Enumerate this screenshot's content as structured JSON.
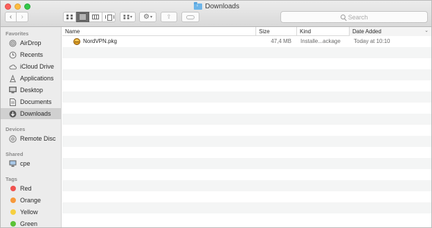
{
  "window": {
    "title": "Downloads",
    "title_icon": "downloads-folder-icon"
  },
  "toolbar": {
    "back_glyph": "‹",
    "forward_glyph": "›",
    "view_modes": [
      "icon",
      "list",
      "column",
      "cover-flow"
    ],
    "active_view": "list",
    "search_placeholder": "Search"
  },
  "sidebar": {
    "favorites_title": "Favorites",
    "favorites": [
      {
        "label": "AirDrop",
        "icon": "airdrop-icon"
      },
      {
        "label": "Recents",
        "icon": "clock-icon"
      },
      {
        "label": "iCloud Drive",
        "icon": "cloud-icon"
      },
      {
        "label": "Applications",
        "icon": "applications-icon"
      },
      {
        "label": "Desktop",
        "icon": "desktop-icon"
      },
      {
        "label": "Documents",
        "icon": "document-icon"
      },
      {
        "label": "Downloads",
        "icon": "download-icon",
        "selected": true
      }
    ],
    "devices_title": "Devices",
    "devices": [
      {
        "label": "Remote Disc",
        "icon": "disc-icon"
      }
    ],
    "shared_title": "Shared",
    "shared": [
      {
        "label": "cpe",
        "icon": "monitor-icon"
      }
    ],
    "tags_title": "Tags",
    "tags": [
      {
        "label": "Red",
        "color": "#f0524f"
      },
      {
        "label": "Orange",
        "color": "#f7993b"
      },
      {
        "label": "Yellow",
        "color": "#f6d040"
      },
      {
        "label": "Green",
        "color": "#5bc236"
      }
    ]
  },
  "columns": {
    "name": "Name",
    "size": "Size",
    "kind": "Kind",
    "date_added": "Date Added",
    "sort_indicator": "⌄"
  },
  "files": [
    {
      "name": "NordVPN.pkg",
      "size": "47,4 MB",
      "kind": "Installe...ackage",
      "date_added": "Today at 10:10",
      "icon": "package-icon"
    }
  ]
}
